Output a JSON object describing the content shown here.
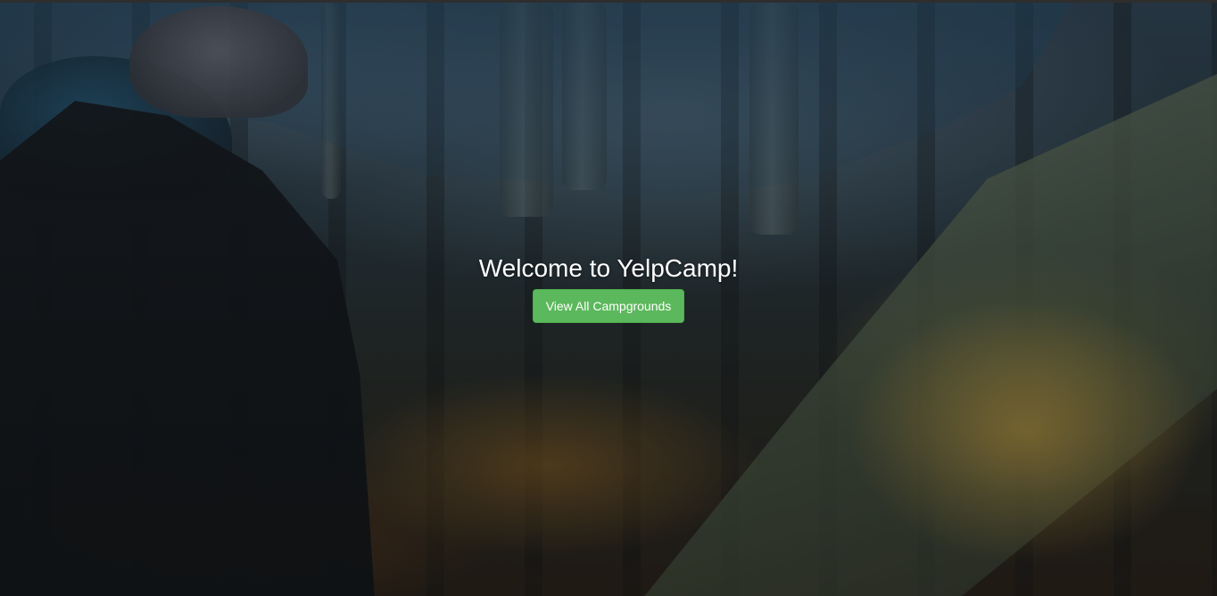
{
  "landing": {
    "heading": "Welcome to YelpCamp!",
    "cta_label": "View All Campgrounds"
  },
  "colors": {
    "cta_background": "#5cb85c",
    "cta_border": "#4cae4c",
    "heading_text": "#ffffff"
  },
  "background": {
    "image_subject": "camping-scene-photo"
  }
}
